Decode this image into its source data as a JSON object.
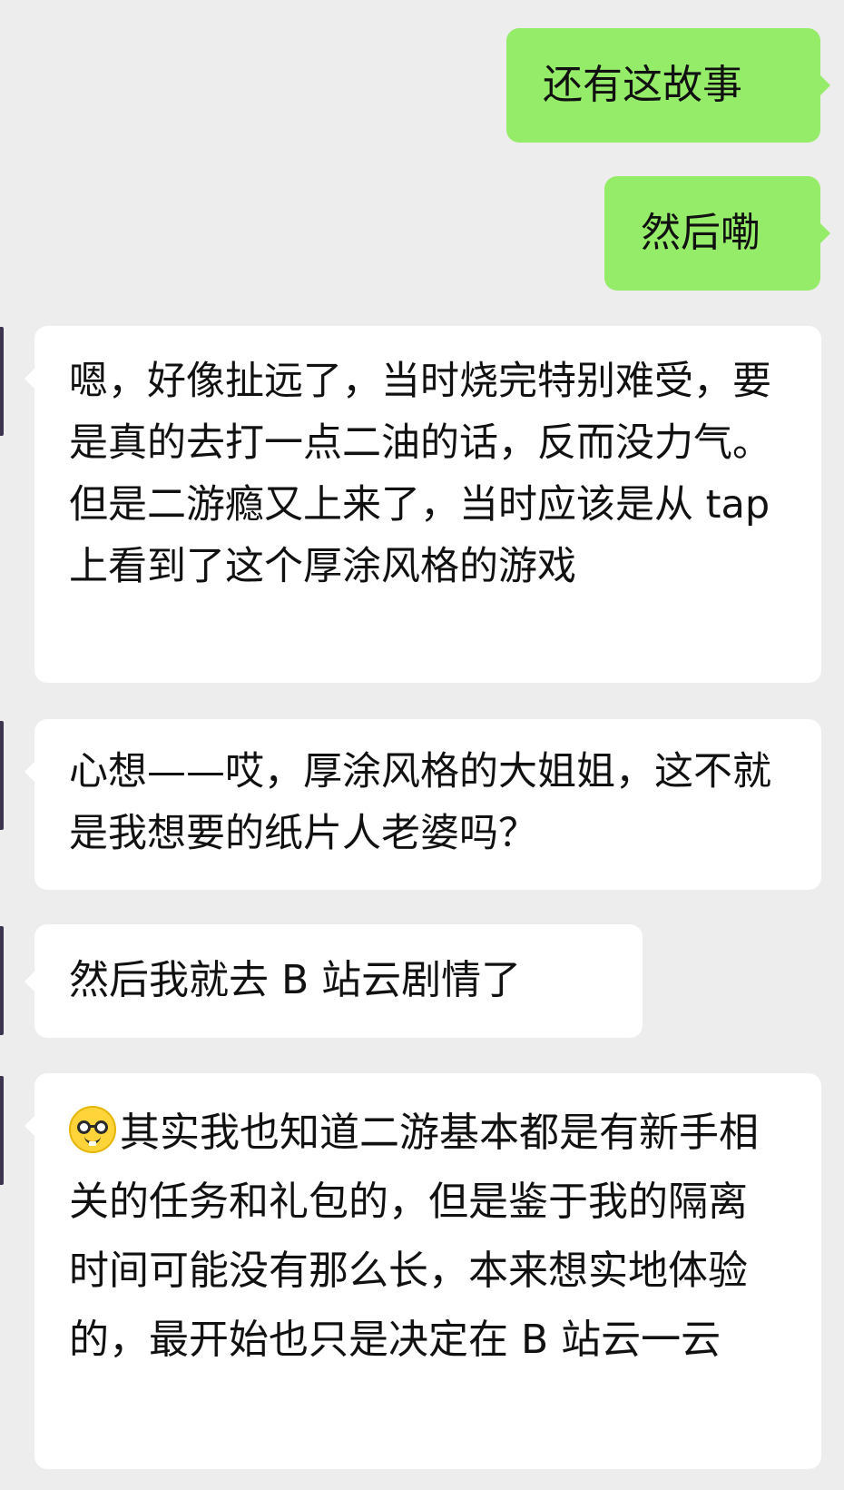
{
  "conversation": {
    "messages": [
      {
        "direction": "outgoing",
        "text": "还有这故事"
      },
      {
        "direction": "outgoing",
        "text": "然后嘞"
      },
      {
        "direction": "incoming",
        "text": "嗯，好像扯远了，当时烧完特别难受，要是真的去打一点二油的话，反而没力气。但是二游瘾又上来了，当时应该是从 tap 上看到了这个厚涂风格的游戏"
      },
      {
        "direction": "incoming",
        "text": "心想——哎，厚涂风格的大姐姐，这不就是我想要的纸片人老婆吗？"
      },
      {
        "direction": "incoming",
        "text": "然后我就去 B 站云剧情了"
      },
      {
        "direction": "incoming",
        "emoji": "nerd-face-icon",
        "text": "其实我也知道二游基本都是有新手相关的任务和礼包的，但是鉴于我的隔离时间可能没有那么长，本来想实地体验的，最开始也只是决定在 B 站云一云"
      }
    ]
  },
  "colors": {
    "background": "#ededed",
    "outgoing_bubble": "#95ec69",
    "incoming_bubble": "#ffffff",
    "text": "#111111"
  }
}
